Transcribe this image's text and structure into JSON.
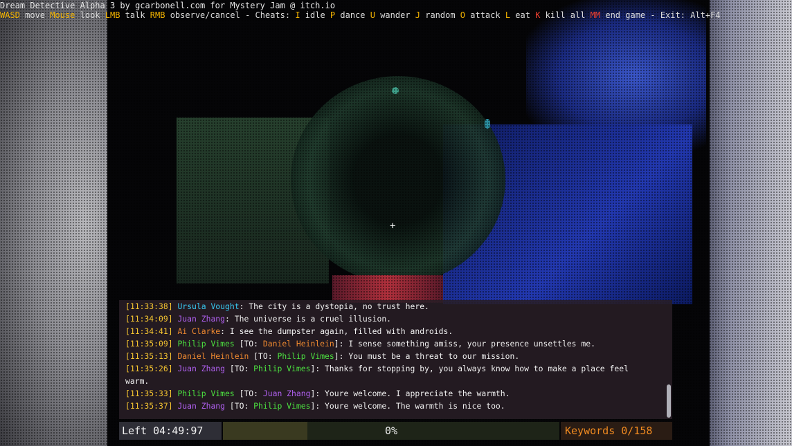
{
  "header": {
    "credit": "Dream Detective Alpha 3 by gcarbonell.com for Mystery Jam @ itch.io",
    "controls": [
      {
        "key": "WASD",
        "label": " move ",
        "color": "key"
      },
      {
        "key": "Mouse",
        "label": " look ",
        "color": "key"
      },
      {
        "key": "LMB",
        "label": " talk ",
        "color": "key"
      },
      {
        "key": "RMB",
        "label": " observe/cancel - Cheats: ",
        "color": "key"
      },
      {
        "key": "I",
        "label": " idle ",
        "color": "key"
      },
      {
        "key": "P",
        "label": " dance ",
        "color": "key"
      },
      {
        "key": "U",
        "label": " wander ",
        "color": "key"
      },
      {
        "key": "J",
        "label": " random ",
        "color": "key"
      },
      {
        "key": "O",
        "label": " attack ",
        "color": "key"
      },
      {
        "key": "L",
        "label": " eat ",
        "color": "key"
      },
      {
        "key": "K",
        "label": " kill all ",
        "color": "key-red"
      },
      {
        "key": "MM",
        "label": " end game - Exit: Alt+F4",
        "color": "key-red"
      }
    ]
  },
  "crosshair": "+",
  "chat": [
    {
      "ts": "[11:33:38]",
      "speaker": "Ursula Vought",
      "speaker_color": "n-cyan",
      "to": null,
      "to_color": null,
      "text": "The city is a dystopia, no trust here."
    },
    {
      "ts": "[11:34:09]",
      "speaker": "Juan Zhang",
      "speaker_color": "n-purple",
      "to": null,
      "to_color": null,
      "text": "The universe is a cruel illusion."
    },
    {
      "ts": "[11:34:41]",
      "speaker": "Ai Clarke",
      "speaker_color": "n-orange",
      "to": null,
      "to_color": null,
      "text": "I see the dumpster again, filled with androids."
    },
    {
      "ts": "[11:35:09]",
      "speaker": "Philip Vimes",
      "speaker_color": "n-green",
      "to": "Daniel Heinlein",
      "to_color": "n-orange",
      "text": "I sense something amiss, your presence unsettles me."
    },
    {
      "ts": "[11:35:13]",
      "speaker": "Daniel Heinlein",
      "speaker_color": "n-orange",
      "to": "Philip Vimes",
      "to_color": "n-green",
      "text": "You must be a threat to our mission."
    },
    {
      "ts": "[11:35:26]",
      "speaker": "Juan Zhang",
      "speaker_color": "n-purple",
      "to": "Philip Vimes",
      "to_color": "n-green",
      "text": "Thanks for stopping by, you always know how to make a place feel warm."
    },
    {
      "ts": "[11:35:33]",
      "speaker": "Philip Vimes",
      "speaker_color": "n-green",
      "to": "Juan Zhang",
      "to_color": "n-purple",
      "text": "Youre welcome. I appreciate the warmth."
    },
    {
      "ts": "[11:35:37]",
      "speaker": "Juan Zhang",
      "speaker_color": "n-purple",
      "to": "Philip Vimes",
      "to_color": "n-green",
      "text": "Youre welcome. The warmth is nice too."
    }
  ],
  "hud": {
    "time_left": "Left 04:49:97",
    "progress_label": "0%",
    "progress_fraction": 0.25,
    "keywords": "Keywords 0/158"
  }
}
